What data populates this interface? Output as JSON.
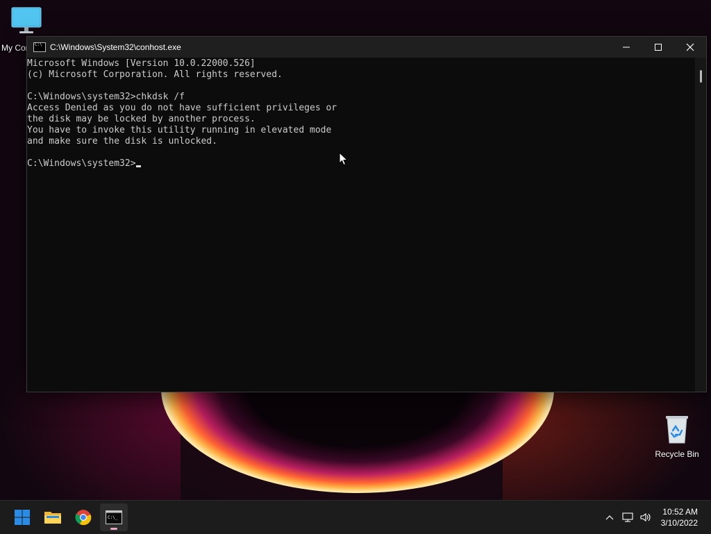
{
  "desktop": {
    "icons": [
      {
        "label": "My Computer"
      },
      {
        "label": "Recycle Bin"
      }
    ]
  },
  "console": {
    "title": "C:\\Windows\\System32\\conhost.exe",
    "lines": [
      "Microsoft Windows [Version 10.0.22000.526]",
      "(c) Microsoft Corporation. All rights reserved.",
      "",
      "C:\\Windows\\system32>chkdsk /f",
      "Access Denied as you do not have sufficient privileges or",
      "the disk may be locked by another process.",
      "You have to invoke this utility running in elevated mode",
      "and make sure the disk is unlocked.",
      "",
      "C:\\Windows\\system32>"
    ],
    "controls": {
      "minimize": "—",
      "maximize": "☐",
      "close": "✕"
    }
  },
  "taskbar": {
    "apps": [
      {
        "name": "start",
        "icon": "windows-logo-icon"
      },
      {
        "name": "file-explorer",
        "icon": "folder-icon"
      },
      {
        "name": "chrome",
        "icon": "chrome-icon"
      },
      {
        "name": "command-prompt",
        "icon": "terminal-icon",
        "active": true
      }
    ],
    "tray": {
      "time": "10:52 AM",
      "date": "3/10/2022"
    }
  },
  "colors": {
    "console_bg": "#0c0c0c",
    "console_text": "#cccccc",
    "taskbar_bg": "#1c1c1c",
    "windows_blue": "#2b8ce6"
  }
}
